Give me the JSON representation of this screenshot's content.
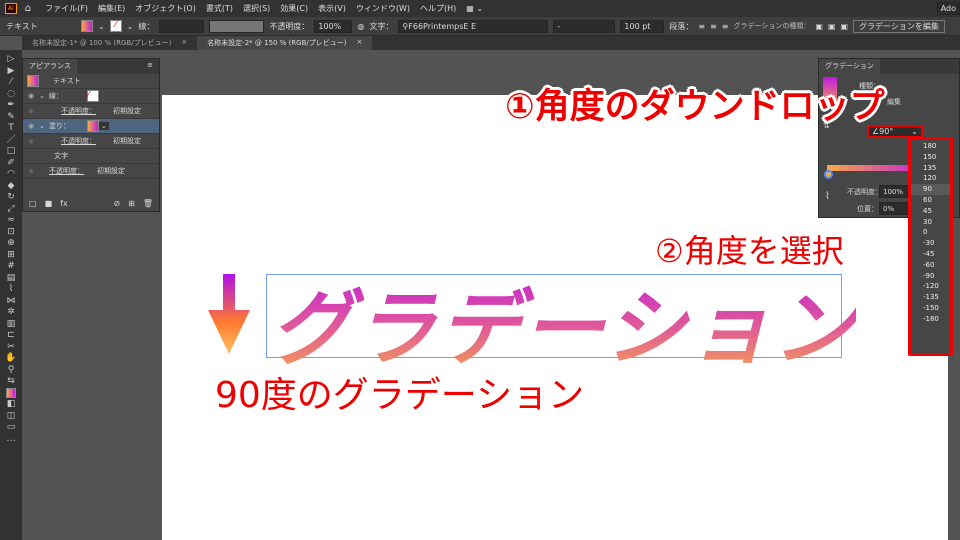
{
  "menubar": {
    "items": [
      "ファイル(F)",
      "編集(E)",
      "オブジェクト(O)",
      "書式(T)",
      "選択(S)",
      "効果(C)",
      "表示(V)",
      "ウィンドウ(W)",
      "ヘルプ(H)"
    ],
    "search_placeholder": "Ado"
  },
  "control": {
    "object_type": "テキスト",
    "stroke_label": "線：",
    "opacity_label": "不透明度：",
    "opacity_value": "100%",
    "char_label": "文字：",
    "font_value": "F66PrintempsE E",
    "style_value": "-",
    "size_value": "100 pt",
    "para_label": "段落：",
    "grad_type_label": "グラデーションの種類：",
    "edit_grad_button": "グラデーションを編集"
  },
  "tabs": [
    {
      "label": "名称未設定-1* @ 100 % (RGB/プレビュー)",
      "active": false
    },
    {
      "label": "名称未設定-2* @ 150 % (RGB/プレビュー)",
      "active": true
    }
  ],
  "appearance": {
    "title": "アピアランス",
    "object": "テキスト",
    "stroke_label": "線：",
    "opacity_label": "不透明度：",
    "opacity_value": "初期設定",
    "fill_label": "塗り：",
    "text_label": "文字"
  },
  "gradient": {
    "title": "グラデーション",
    "type_label": "種類：",
    "edit_label": "編集",
    "angle_value": "90°",
    "opacity_label": "不透明度：",
    "opacity_value": "100%",
    "position_label": "位置：",
    "position_value": "0%"
  },
  "angle_options": [
    "180",
    "150",
    "135",
    "120",
    "90",
    "60",
    "45",
    "30",
    "0",
    "-30",
    "-45",
    "-60",
    "-90",
    "-120",
    "-135",
    "-150",
    "-180"
  ],
  "angle_selected": "90",
  "canvas": {
    "gradient_text": "グラデーション"
  },
  "annotations": {
    "step1": "①角度のダウンドロップ",
    "step2": "②角度を選択",
    "caption": "90度のグラデーション"
  },
  "colors": {
    "gradient_start": "#c018e0",
    "gradient_end": "#f8a848",
    "annotation": "#ee0000"
  }
}
